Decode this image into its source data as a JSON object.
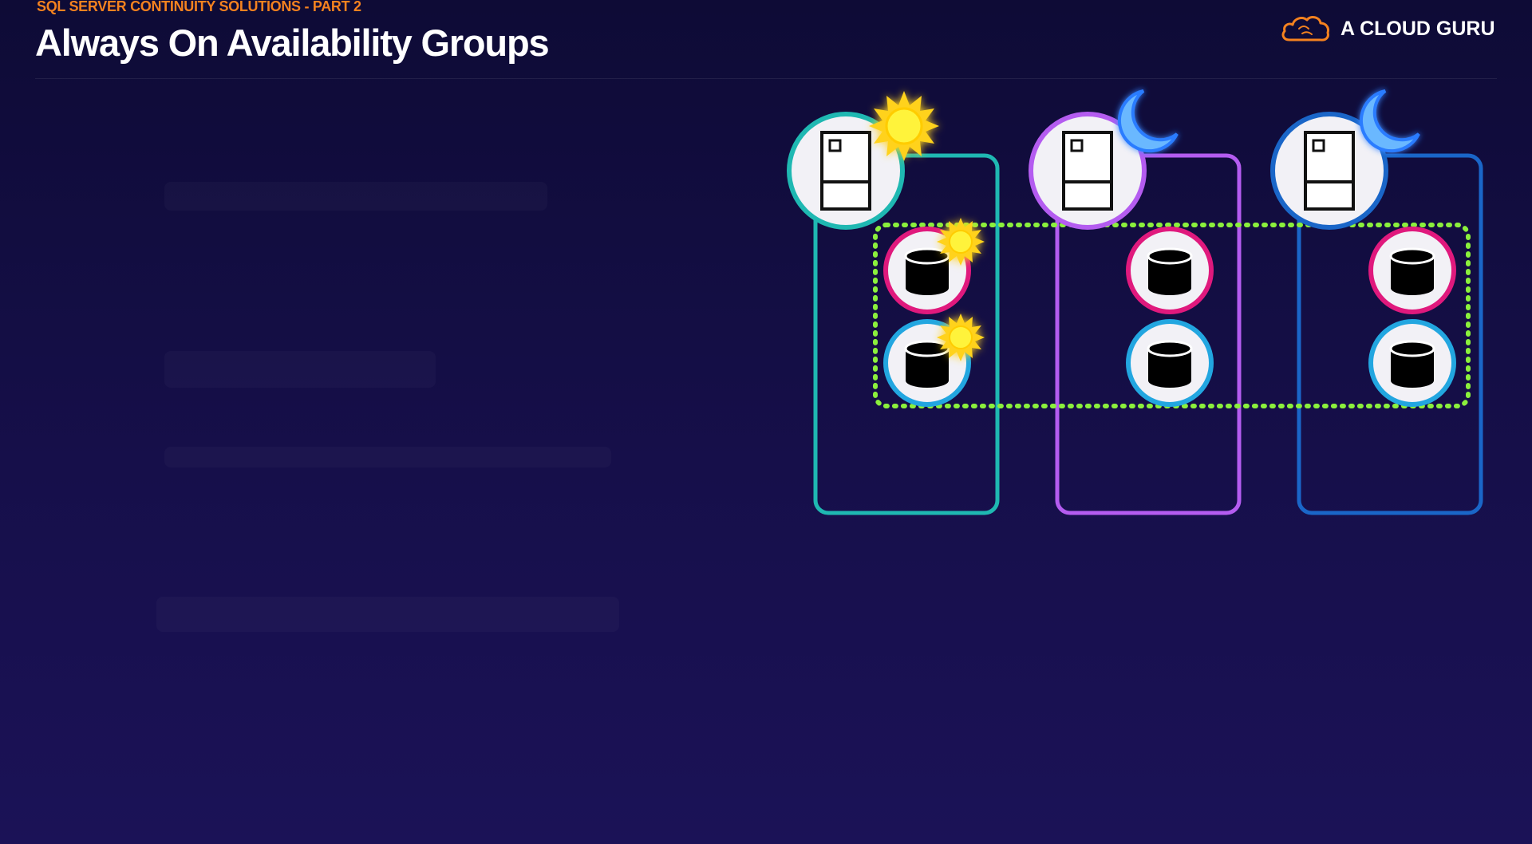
{
  "header": {
    "kicker": "SQL SERVER CONTINUITY SOLUTIONS - PART 2",
    "title": "Always On Availability Groups"
  },
  "brand": {
    "name": "A CLOUD GURU",
    "logo_icon": "cloud-icon",
    "accent": "#f5821f"
  },
  "diagram": {
    "nodes": [
      {
        "id": "node-1",
        "state": "sun",
        "state_icon": "sun-icon",
        "server_icon": "server-icon",
        "color": "#1fb8b2",
        "databases": [
          {
            "ring": "#e0197d",
            "marker": "sun"
          },
          {
            "ring": "#22a6e0",
            "marker": "sun"
          }
        ]
      },
      {
        "id": "node-2",
        "state": "moon",
        "state_icon": "moon-icon",
        "server_icon": "server-icon",
        "color": "#b45cf0",
        "databases": [
          {
            "ring": "#e0197d",
            "marker": null
          },
          {
            "ring": "#22a6e0",
            "marker": null
          }
        ]
      },
      {
        "id": "node-3",
        "state": "moon",
        "state_icon": "moon-icon",
        "server_icon": "server-icon",
        "color": "#1a66c8",
        "databases": [
          {
            "ring": "#e0197d",
            "marker": null
          },
          {
            "ring": "#22a6e0",
            "marker": null
          }
        ]
      }
    ],
    "availability_group_border": "#8bf03c",
    "database_icon": "database-icon"
  }
}
